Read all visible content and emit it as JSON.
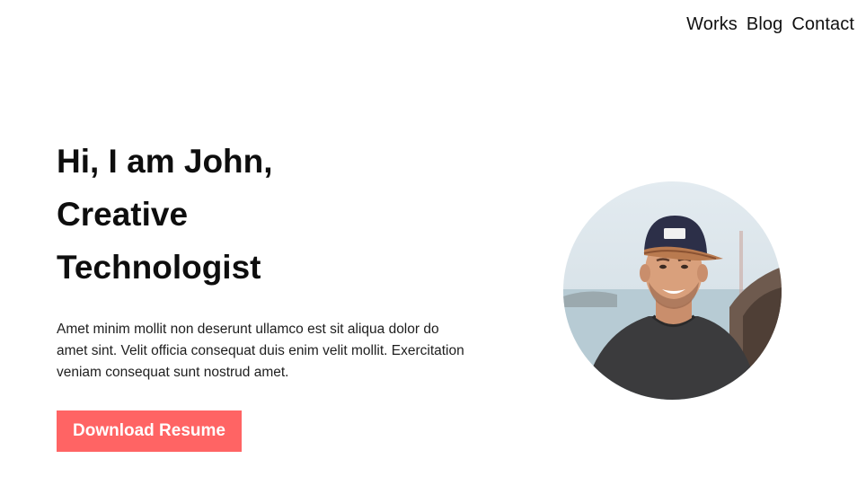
{
  "nav": {
    "items": [
      {
        "label": "Works"
      },
      {
        "label": "Blog"
      },
      {
        "label": "Contact"
      }
    ]
  },
  "hero": {
    "title_lines": [
      "Hi, I am John,",
      "Creative",
      "Technologist"
    ],
    "description": "Amet minim mollit non deserunt ullamco est sit aliqua dolor do amet sint. Velit officia consequat duis enim velit mollit. Exercitation veniam consequat sunt nostrud amet.",
    "cta_label": "Download Resume"
  },
  "colors": {
    "accent": "#ff6464",
    "text": "#111111",
    "background": "#ffffff"
  }
}
